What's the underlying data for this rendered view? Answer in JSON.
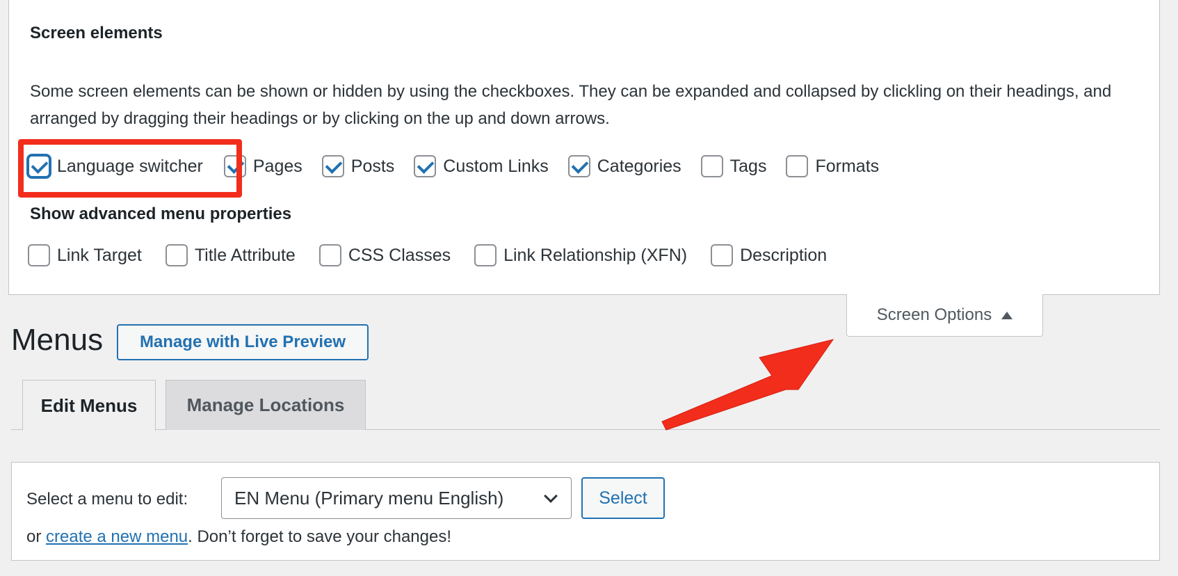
{
  "screen_options": {
    "heading": "Screen elements",
    "description": "Some screen elements can be shown or hidden by using the checkboxes. They can be expanded and collapsed by clickling on their headings, and arranged by dragging their headings or by clicking on the up and down arrows.",
    "elements": [
      {
        "label": "Language switcher",
        "checked": true
      },
      {
        "label": "Pages",
        "checked": true
      },
      {
        "label": "Posts",
        "checked": true
      },
      {
        "label": "Custom Links",
        "checked": true
      },
      {
        "label": "Categories",
        "checked": true
      },
      {
        "label": "Tags",
        "checked": false
      },
      {
        "label": "Formats",
        "checked": false
      }
    ],
    "advanced_heading": "Show advanced menu properties",
    "advanced": [
      {
        "label": "Link Target",
        "checked": false
      },
      {
        "label": "Title Attribute",
        "checked": false
      },
      {
        "label": "CSS Classes",
        "checked": false
      },
      {
        "label": "Link Relationship (XFN)",
        "checked": false
      },
      {
        "label": "Description",
        "checked": false
      }
    ],
    "tab_label": "Screen Options"
  },
  "page": {
    "title": "Menus",
    "live_preview_label": "Manage with Live Preview"
  },
  "tabs": [
    {
      "label": "Edit Menus",
      "active": true
    },
    {
      "label": "Manage Locations",
      "active": false
    }
  ],
  "menu_select": {
    "label": "Select a menu to edit:",
    "selected": "EN Menu (Primary menu English)",
    "button_label": "Select",
    "note_prefix": "or",
    "note_link": "create a new menu",
    "note_suffix": ". Don’t forget to save your changes!"
  },
  "annotations": {
    "highlight_color": "#f22d1c",
    "arrow_color": "#f22d1c"
  },
  "colors": {
    "accent": "#2271b1",
    "background": "#f0f0f1"
  }
}
